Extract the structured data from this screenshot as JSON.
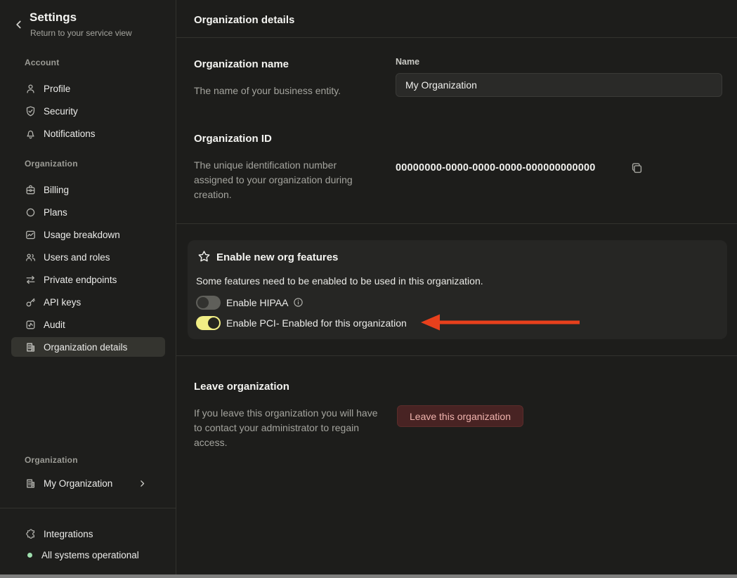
{
  "sidebar": {
    "title": "Settings",
    "subtitle": "Return to your service view",
    "sections": [
      {
        "label": "Account",
        "items": [
          {
            "icon": "user-icon",
            "label": "Profile"
          },
          {
            "icon": "shield-check-icon",
            "label": "Security"
          },
          {
            "icon": "bell-icon",
            "label": "Notifications"
          }
        ]
      },
      {
        "label": "Organization",
        "items": [
          {
            "icon": "billing-icon",
            "label": "Billing"
          },
          {
            "icon": "circle-icon",
            "label": "Plans"
          },
          {
            "icon": "usage-chart-icon",
            "label": "Usage breakdown"
          },
          {
            "icon": "users-icon",
            "label": "Users and roles"
          },
          {
            "icon": "arrows-icon",
            "label": "Private endpoints"
          },
          {
            "icon": "key-icon",
            "label": "API keys"
          },
          {
            "icon": "audit-icon",
            "label": "Audit"
          },
          {
            "icon": "building-icon",
            "label": "Organization details",
            "selected": true
          }
        ]
      }
    ],
    "org_switcher": {
      "label": "Organization",
      "name": "My Organization"
    },
    "footer": {
      "integrations_label": "Integrations",
      "status_label": "All systems operational",
      "status_color": "#9fdfae"
    }
  },
  "main": {
    "header_title": "Organization details",
    "org_name": {
      "heading": "Organization name",
      "description": "The name of your business entity.",
      "field_label": "Name",
      "field_value": "My Organization"
    },
    "org_id": {
      "heading": "Organization ID",
      "description": "The unique identification number assigned to your organization during creation.",
      "value": "00000000-0000-0000-0000-000000000000"
    },
    "features_card": {
      "title": "Enable new org features",
      "description": "Some features need to be enabled to be used in this organization.",
      "toggles": [
        {
          "label": "Enable HIPAA",
          "enabled": false,
          "has_info": true
        },
        {
          "label": "Enable PCI- Enabled for this organization",
          "enabled": true
        }
      ]
    },
    "leave": {
      "heading": "Leave organization",
      "description": "If you leave this organization you will have to contact your administrator to regain access.",
      "button_label": "Leave this organization"
    }
  },
  "colors": {
    "toggle_on": "#f1ee85",
    "annotation_arrow": "#e8401c",
    "danger_button_bg": "#482323",
    "danger_button_text": "#f0b3ad"
  }
}
